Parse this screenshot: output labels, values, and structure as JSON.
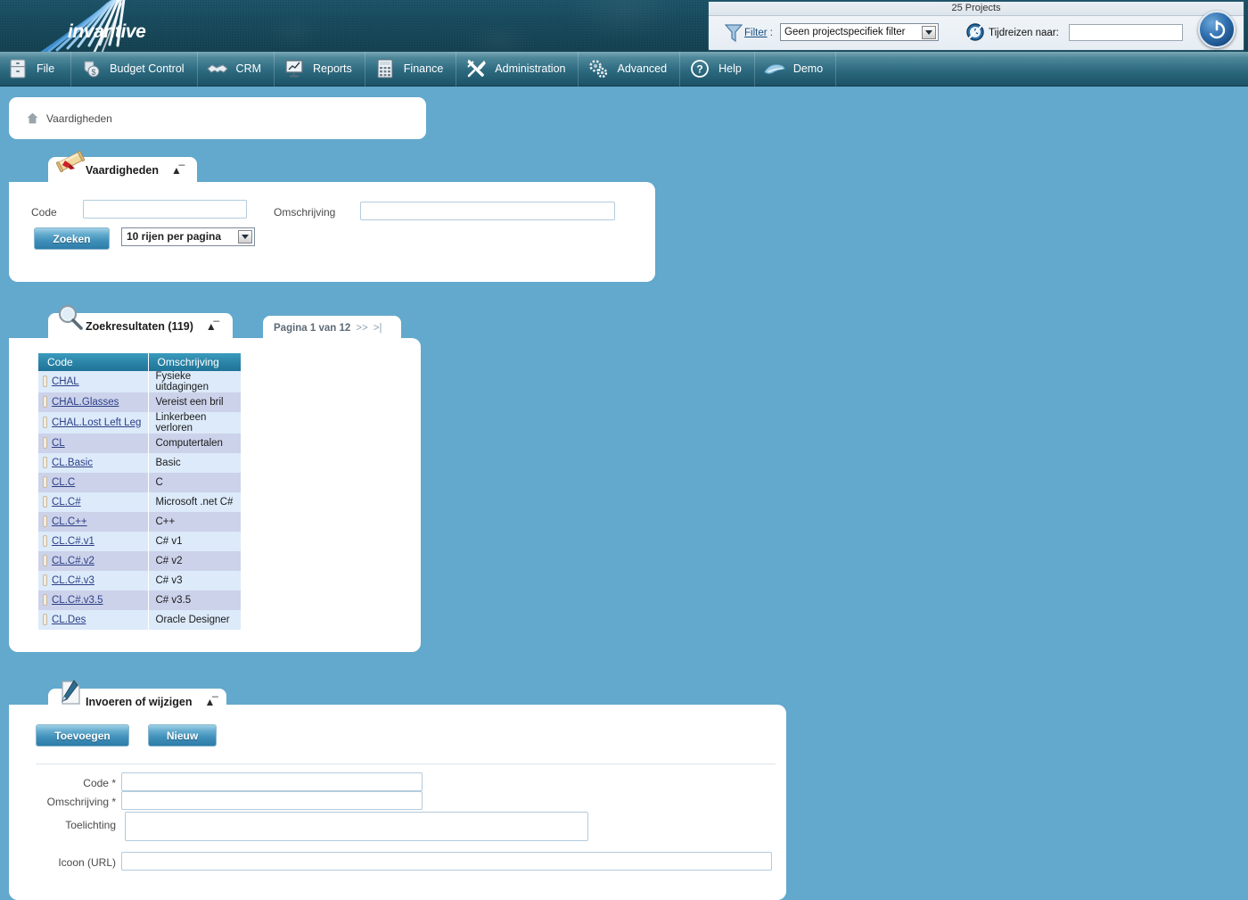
{
  "app": {
    "brand": "invantive",
    "logo_icon": "fan-burst-logo"
  },
  "topbar": {
    "projects_count_label": "25 Projects",
    "filter_icon": "funnel-icon",
    "filter_label": "Filter",
    "filter_separator": " :",
    "filter_value": "Geen projectspecifiek filter",
    "dropdown_icon": "chevron-down-icon",
    "timetravel_icon": "clock-no-icon",
    "timetravel_label": "Tijdreizen naar:",
    "timetravel_value": "",
    "timetravel_placeholder": "",
    "power_icon": "power-icon"
  },
  "menu": {
    "items": [
      {
        "label": "File",
        "icon": "cabinet-icon"
      },
      {
        "label": "Budget Control",
        "icon": "money-shield-icon"
      },
      {
        "label": "CRM",
        "icon": "handshake-icon"
      },
      {
        "label": "Reports",
        "icon": "presentation-chart-icon"
      },
      {
        "label": "Finance",
        "icon": "calculator-icon"
      },
      {
        "label": "Administration",
        "icon": "tools-wrench-icon"
      },
      {
        "label": "Advanced",
        "icon": "gears-icon"
      },
      {
        "label": "Help",
        "icon": "question-circle-icon"
      },
      {
        "label": "Demo",
        "icon": "feather-icon"
      }
    ]
  },
  "breadcrumb": {
    "home_icon": "home-icon",
    "text": "Vaardigheden"
  },
  "search_panel": {
    "title": "Vaardigheden",
    "icon": "diploma-scroll-icon",
    "collapse_icon": "chevron-up-icon",
    "code_label": "Code",
    "code_value": "",
    "description_label": "Omschrijving",
    "description_value": "",
    "search_button": "Zoeken",
    "rows_per_page": "10 rijen per pagina"
  },
  "results_panel": {
    "title": "Zoekresultaten (119)",
    "icon": "magnifier-icon",
    "collapse_icon": "chevron-up-icon",
    "pagination": {
      "label": "Pagina 1 van 12",
      "next": ">>",
      "last": ">|"
    },
    "columns": [
      "Code",
      "Omschrijving"
    ],
    "rows": [
      {
        "code": "CHAL",
        "description": "Fysieke uitdagingen"
      },
      {
        "code": "CHAL.Glasses",
        "description": "Vereist een bril"
      },
      {
        "code": "CHAL.Lost Left Leg",
        "description": "Linkerbeen verloren"
      },
      {
        "code": "CL",
        "description": "Computertalen"
      },
      {
        "code": "CL.Basic",
        "description": "Basic"
      },
      {
        "code": "CL.C",
        "description": "C"
      },
      {
        "code": "CL.C#",
        "description": "Microsoft .net C#"
      },
      {
        "code": "CL.C++",
        "description": "C++"
      },
      {
        "code": "CL.C#.v1",
        "description": "C# v1"
      },
      {
        "code": "CL.C#.v2",
        "description": "C# v2"
      },
      {
        "code": "CL.C#.v3",
        "description": "C# v3"
      },
      {
        "code": "CL.C#.v3.5",
        "description": "C# v3.5"
      },
      {
        "code": "CL.Des",
        "description": "Oracle Designer"
      }
    ]
  },
  "edit_panel": {
    "title": "Invoeren of wijzigen",
    "icon": "document-pen-icon",
    "collapse_icon": "chevron-up-icon",
    "add_button": "Toevoegen",
    "new_button": "Nieuw",
    "fields": [
      {
        "label": "Code *",
        "value": ""
      },
      {
        "label": "Omschrijving *",
        "value": ""
      },
      {
        "label": "Toelichting",
        "value": ""
      },
      {
        "label": "Icoon (URL)",
        "value": ""
      }
    ]
  },
  "colors": {
    "page_background": "#63a8cd",
    "banner": "#17495c",
    "menubar": "#2d6a80",
    "table_header": "#2d87ab",
    "row_odd": "#dceafa",
    "row_even": "#ccd2ea",
    "link": "#2c3f86",
    "button": "#3f90ba"
  }
}
